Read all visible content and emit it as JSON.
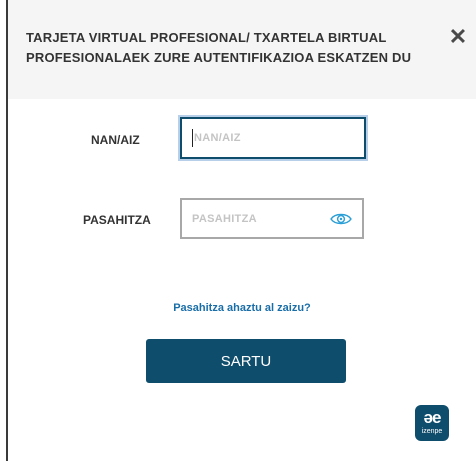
{
  "header": {
    "title": "TARJETA VIRTUAL PROFESIONAL/ TXARTELA BIRTUAL PROFESIONALAEK ZURE AUTENTIFIKAZIOA ESKATZEN DU",
    "close_glyph": "✕"
  },
  "form": {
    "nan_label": "NAN/AIZ",
    "nan_placeholder": "NAN/AIZ",
    "nan_value": "",
    "password_label": "PASAHITZA",
    "password_placeholder": "PASAHITZA",
    "password_value": "",
    "password_toggle_icon": "eye-icon",
    "forgot_link": "Pasahitza ahaztu al zaizu?",
    "submit_label": "SARTU"
  },
  "brand": {
    "logo_mark": "əe",
    "logo_text": "izenpe",
    "primary_color": "#0e4d6c",
    "link_color": "#1a6ea8"
  }
}
